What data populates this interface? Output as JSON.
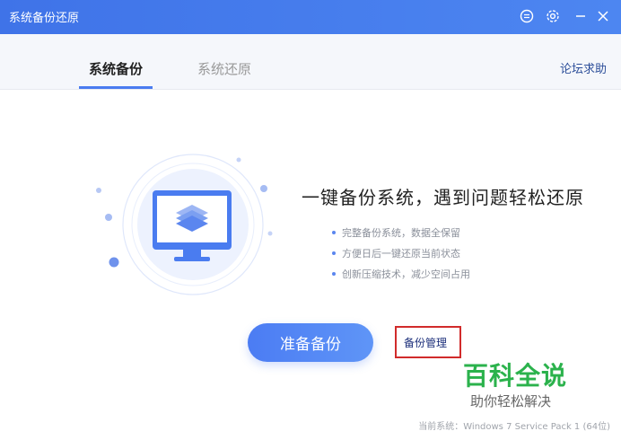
{
  "window": {
    "title": "系统备份还原"
  },
  "tabs": [
    {
      "label": "系统备份",
      "active": true
    },
    {
      "label": "系统还原",
      "active": false
    }
  ],
  "forum_link": "论坛求助",
  "headline": "一键备份系统，遇到问题轻松还原",
  "features": [
    "完整备份系统，数据全保留",
    "方便日后一键还原当前状态",
    "创新压缩技术，减少空间占用"
  ],
  "primary_button": "准备备份",
  "manage_link": "备份管理",
  "watermark": {
    "title": "百科全说",
    "subtitle": "助你轻松解决"
  },
  "status": "当前系统：Windows 7 Service Pack 1 (64位)",
  "colors": {
    "accent": "#4a7cf0",
    "highlight_box": "#d12b2b",
    "watermark_green": "#2bb24c"
  },
  "icons": {
    "feedback": "feedback-icon",
    "settings": "gear-icon",
    "minimize": "minimize-icon",
    "close": "close-icon",
    "illustration": "monitor-layers-icon"
  }
}
